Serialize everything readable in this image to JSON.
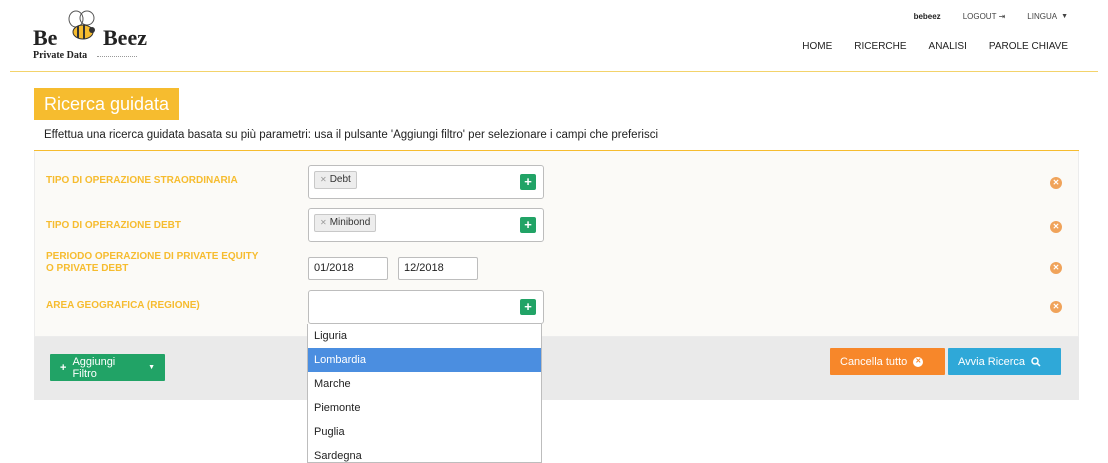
{
  "logo": {
    "part1": "Be",
    "part2": "Beez",
    "tagline": "Private Data"
  },
  "topbar": {
    "user": "bebeez",
    "logout": "LOGOUT",
    "logout_icon": "sign-out-icon",
    "language": "LINGUA"
  },
  "nav": [
    "HOME",
    "RICERCHE",
    "ANALISI",
    "PAROLE CHIAVE"
  ],
  "page": {
    "title": "Ricerca guidata",
    "subtitle": "Effettua una ricerca guidata basata su più parametri: usa il pulsante 'Aggiungi filtro' per selezionare i campi che preferisci"
  },
  "filters": [
    {
      "label": "TIPO DI OPERAZIONE STRAORDINARIA",
      "tag": "Debt"
    },
    {
      "label": "TIPO DI OPERAZIONE DEBT",
      "tag": "Minibond"
    },
    {
      "label_line1": "PERIODO OPERAZIONE DI PRIVATE EQUITY",
      "label_line2": "O PRIVATE DEBT",
      "from": "01/2018",
      "to": "12/2018"
    },
    {
      "label": "AREA GEOGRAFICA (REGIONE)",
      "tag": ""
    }
  ],
  "buttons": {
    "add_filter": "Aggiungi Filtro",
    "clear_all": "Cancella tutto",
    "start_search": "Avvia Ricerca"
  },
  "dropdown": {
    "items": [
      "Liguria",
      "Lombardia",
      "Marche",
      "Piemonte",
      "Puglia",
      "Sardegna"
    ],
    "highlighted": "Lombardia"
  },
  "colors": {
    "accent": "#f6bc2f",
    "green": "#21a366",
    "orange": "#f7872a",
    "blue": "#2fa8d8",
    "highlight": "#4b8ee0"
  }
}
